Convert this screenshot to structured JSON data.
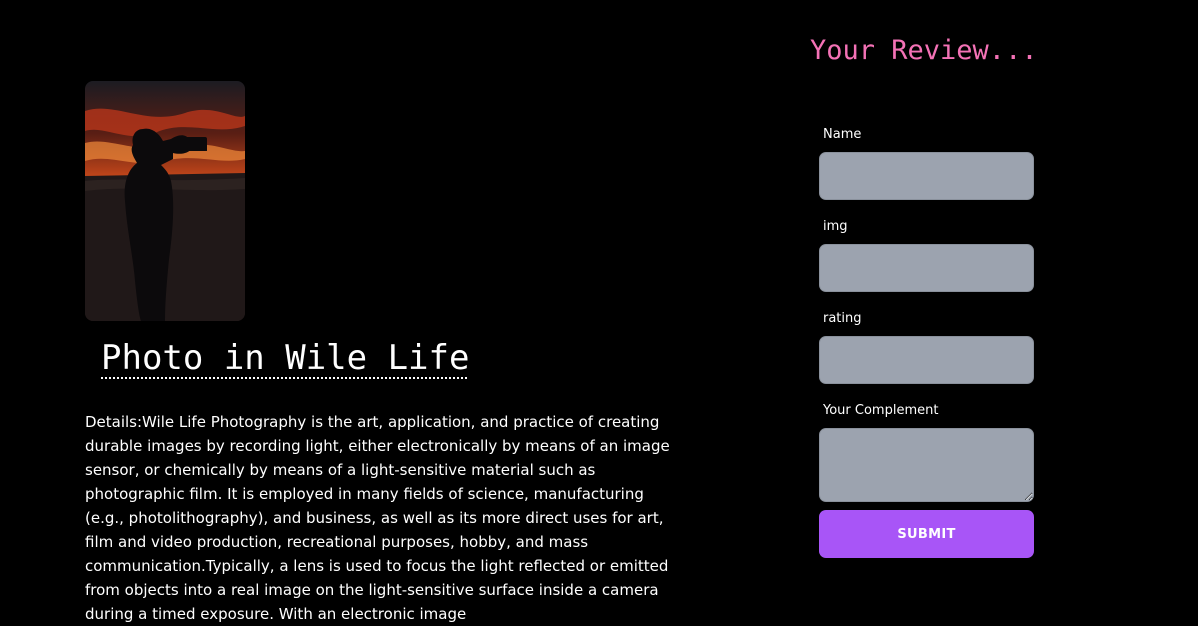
{
  "product": {
    "image_alt": "Silhouette of a photographer with a camera against a sunset sky",
    "title": "Photo in Wile Life",
    "details": "Details:Wile Life Photography is the art, application, and practice of creating durable images by recording light, either electronically by means of an image sensor, or chemically by means of a light-sensitive material such as photographic film. It is employed in many fields of science, manufacturing (e.g., photolithography), and business, as well as its more direct uses for art, film and video production, recreational purposes, hobby, and mass communication.Typically, a lens is used to focus the light reflected or emitted from objects into a real image on the light-sensitive surface inside a camera during a timed exposure. With an electronic image"
  },
  "review": {
    "heading": "Your Review...",
    "fields": {
      "name": {
        "label": "Name",
        "value": ""
      },
      "img": {
        "label": "img",
        "value": ""
      },
      "rating": {
        "label": "rating",
        "value": ""
      },
      "complement": {
        "label": "Your Complement",
        "value": ""
      }
    },
    "submit_label": "SUBMIT"
  },
  "colors": {
    "background": "#000000",
    "heading_accent": "#f472b6",
    "input_bg": "#9ca3af",
    "button_bg": "#a855f7"
  }
}
